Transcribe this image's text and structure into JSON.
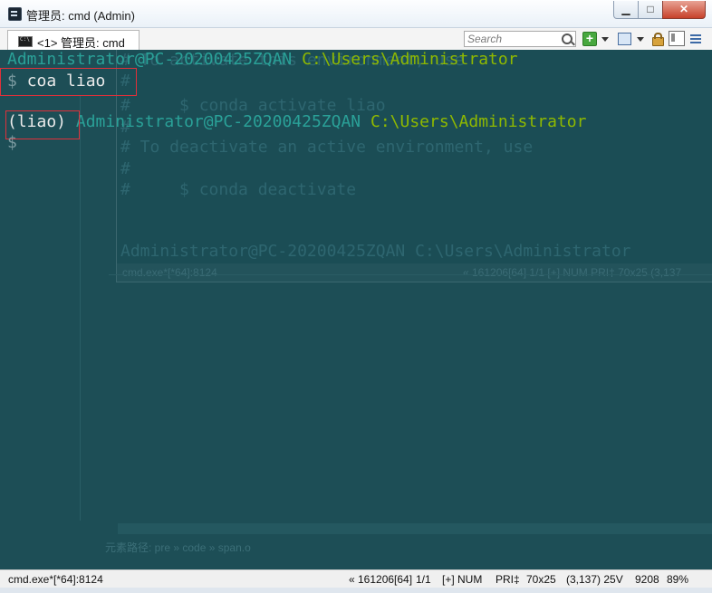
{
  "window": {
    "title": "管理员: cmd (Admin)",
    "minimize_glyph": "▁",
    "maximize_glyph": "□",
    "close_glyph": "✕"
  },
  "tab": {
    "label": "<1> 管理员: cmd"
  },
  "toolbar": {
    "search_placeholder": "Search",
    "new_console_glyph": "+"
  },
  "console": {
    "line1_user": "Administrator@PC-20200425ZQAN",
    "line1_path": "C:\\Users\\Administrator",
    "line2_prompt": "$",
    "line2_command": "coa liao",
    "line3_env": "(liao)",
    "line3_user": "Administrator@PC-20200425ZQAN",
    "line3_path": "C:\\Users\\Administrator",
    "line4_prompt": "$"
  },
  "ghost_console": {
    "lines": [
      "# To activate this environment, use",
      "#",
      "#     $ conda activate liao",
      "#",
      "# To deactivate an active environment, use",
      "#",
      "#     $ conda deactivate",
      "",
      "Administrator@PC-20200425ZQAN C:\\Users\\Administrator"
    ],
    "status_left": "cmd.exe*[*64]:8124",
    "status_right": "« 161206[64]  1/1   [+] NUM  PRI‡  70x25   (3,137",
    "element_path": "元素路径: pre » code » span.o"
  },
  "statusbar": {
    "process": "cmd.exe*[*64]:8124",
    "build": "« 161206[64]",
    "pages": "1/1",
    "flags": "[+] NUM",
    "priority": "PRI‡",
    "size": "70x25",
    "cursor": "(3,137) 25V",
    "pid": "9208",
    "zoom": "89%"
  },
  "colors": {
    "console_bg": "#1d4e56",
    "user_color": "#2aa198",
    "path_color": "#8fb900",
    "highlight_box": "#e0303a"
  }
}
